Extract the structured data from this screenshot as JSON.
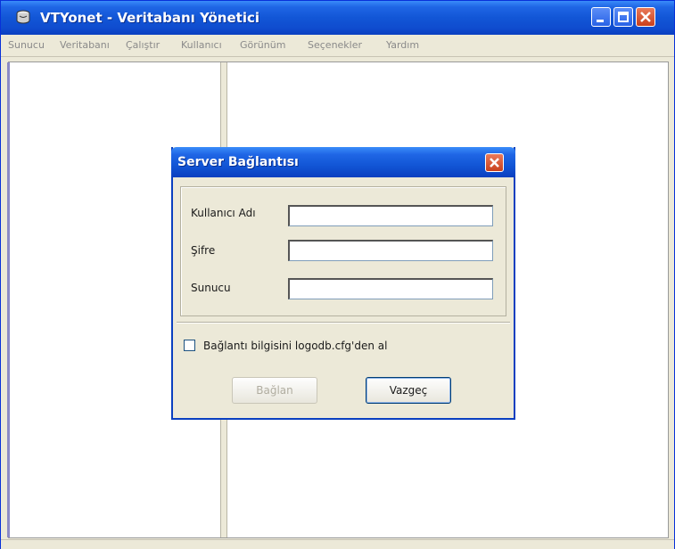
{
  "window": {
    "title": "VTYonet - Veritabanı Yönetici",
    "menu": [
      "Sunucu",
      "Veritabanı",
      "Çalıştır",
      "Kullanıcı",
      "Görünüm",
      "Seçenekler",
      "Yardım"
    ]
  },
  "dialog": {
    "title": "Server Bağlantısı",
    "fields": [
      {
        "label": "Kullanıcı Adı",
        "value": ""
      },
      {
        "label": "Şifre",
        "value": ""
      },
      {
        "label": "Sunucu",
        "value": ""
      }
    ],
    "checkbox_label": "Bağlantı bilgisini logodb.cfg'den al",
    "checkbox_checked": false,
    "connect_button": "Bağlan",
    "cancel_button": "Vazgeç"
  },
  "colors": {
    "titlebar": "#1256d6",
    "window_bg": "#ece9d8",
    "close_button": "#c9401c"
  }
}
